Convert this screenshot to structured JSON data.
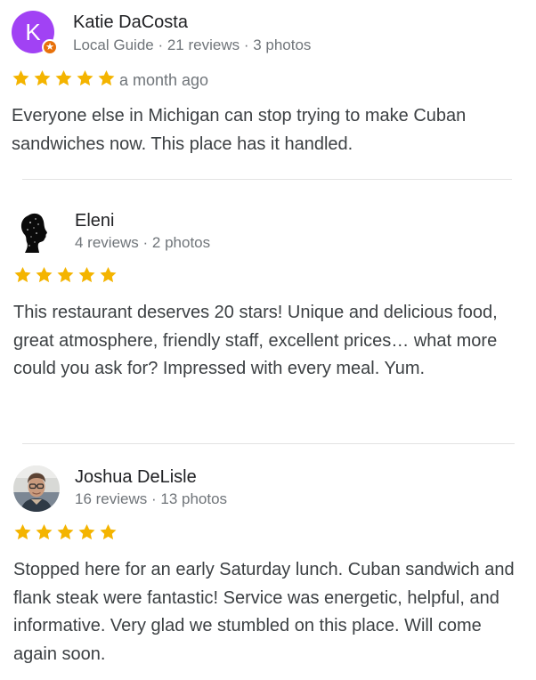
{
  "reviews": [
    {
      "author": "Katie DaCosta",
      "avatar_letter": "K",
      "meta": "Local Guide · 21 reviews · 3 photos",
      "rating": 5,
      "date": "a month ago",
      "text": "Everyone else in Michigan can stop trying to make Cuban sandwiches now. This place has it handled."
    },
    {
      "author": "Eleni",
      "meta": "4 reviews · 2 photos",
      "rating": 5,
      "text": "This restaurant deserves 20 stars! Unique and delicious food, great atmosphere, friendly staff, excellent prices… what more could you ask for? Impressed with every meal. Yum."
    },
    {
      "author": "Joshua DeLisle",
      "meta": "16 reviews · 13 photos",
      "rating": 5,
      "text": "Stopped here for an early Saturday lunch. Cuban sandwich and flank steak were fantastic! Service was energetic, helpful, and informative. Very glad we stumbled on this place. Will come again soon."
    }
  ],
  "colors": {
    "star": "#f4b400",
    "avatar_bg": "#a142f4",
    "guide_badge": "#e8710a",
    "meta_text": "#70757a",
    "body_text": "#3c4043"
  }
}
